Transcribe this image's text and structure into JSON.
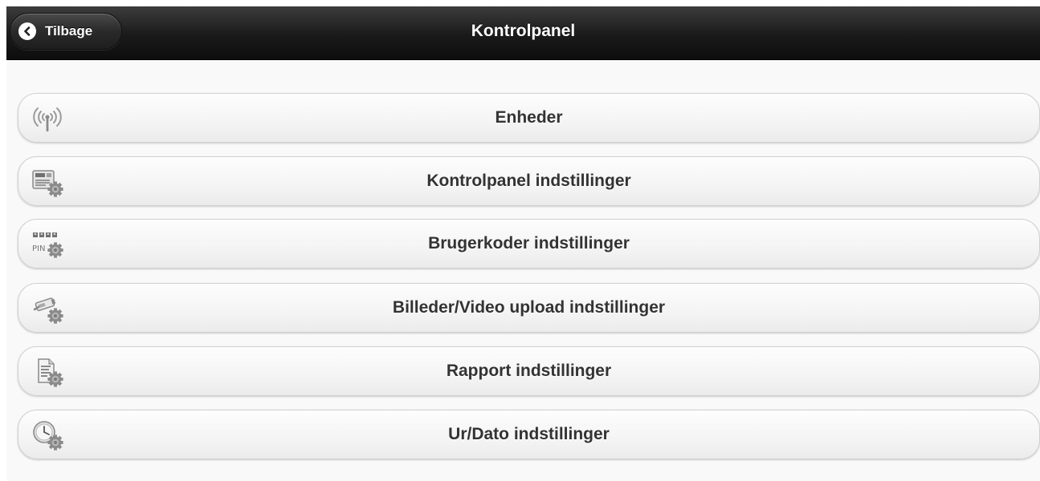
{
  "header": {
    "title": "Kontrolpanel",
    "back_label": "Tilbage"
  },
  "menu": {
    "items": [
      {
        "label": "Enheder",
        "icon": "antenna-signal-icon"
      },
      {
        "label": "Kontrolpanel indstillinger",
        "icon": "control-panel-gear-icon"
      },
      {
        "label": "Brugerkoder indstillinger",
        "icon": "pin-code-gear-icon",
        "icon_text": "PIN"
      },
      {
        "label": "Billeder/Video upload indstillinger",
        "icon": "camera-gear-icon"
      },
      {
        "label": "Rapport indstillinger",
        "icon": "report-gear-icon"
      },
      {
        "label": "Ur/Dato indstillinger",
        "icon": "clock-gear-icon"
      }
    ]
  },
  "colors": {
    "header_dark": "#1a1a1a",
    "button_bg": "#f4f4f4",
    "label_text": "#333333",
    "page_bg": "#f9f9f9"
  }
}
